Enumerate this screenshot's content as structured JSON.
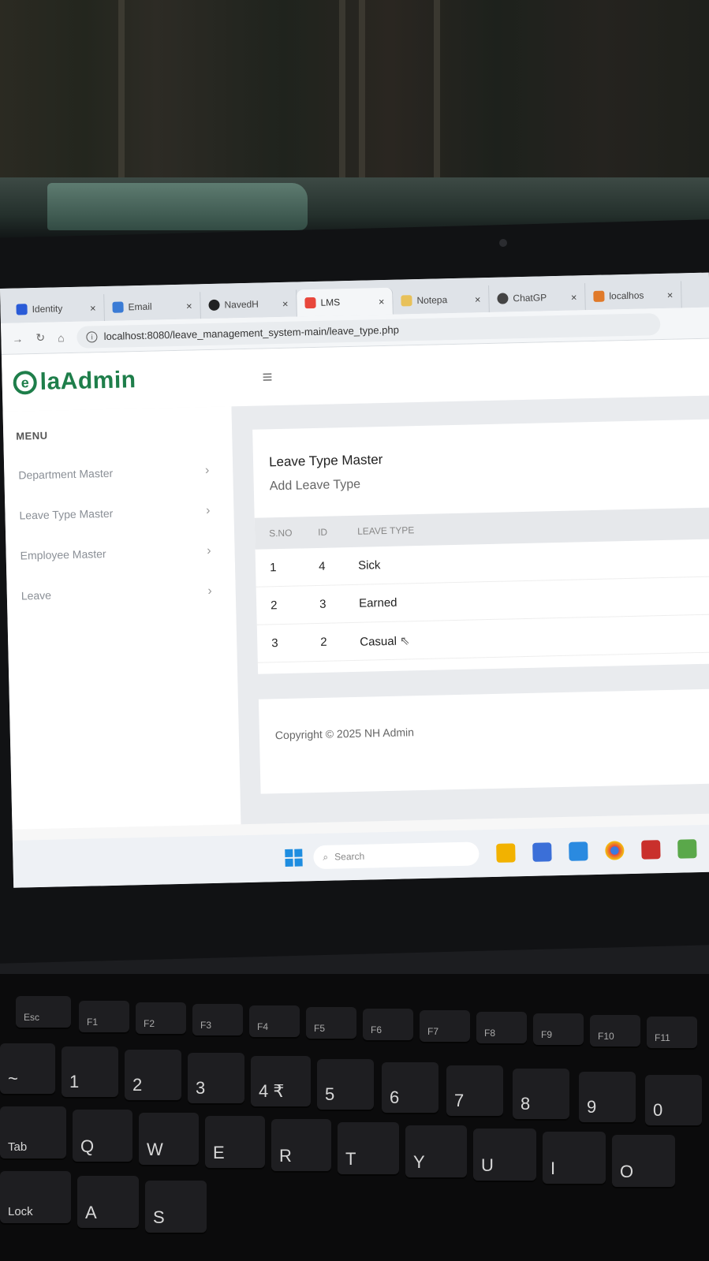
{
  "browser": {
    "tabs": [
      {
        "label": "Identity",
        "icon_color": "#2a5bd7",
        "active": false
      },
      {
        "label": "Email",
        "icon_color": "#3a7bd5",
        "active": false
      },
      {
        "label": "NavedH",
        "icon_color": "#222222",
        "active": false
      },
      {
        "label": "LMS",
        "icon_color": "#e8473c",
        "active": true
      },
      {
        "label": "Notepa",
        "icon_color": "#e8c15a",
        "active": false
      },
      {
        "label": "ChatGP",
        "icon_color": "#444444",
        "active": false
      },
      {
        "label": "localhos",
        "icon_color": "#e07a2a",
        "active": false
      }
    ],
    "close_glyph": "×",
    "url": "localhost:8080/leave_management_system-main/leave_type.php"
  },
  "app": {
    "logo_letter": "e",
    "logo_text": "laAdmin",
    "brand_color": "#1e7e4a"
  },
  "sidebar": {
    "menu_title": "MENU",
    "items": [
      {
        "label": "Department Master"
      },
      {
        "label": "Leave Type Master"
      },
      {
        "label": "Employee Master"
      },
      {
        "label": "Leave"
      }
    ]
  },
  "main": {
    "card_title": "Leave Type Master",
    "add_link": "Add Leave Type",
    "table": {
      "headers": [
        "S.NO",
        "ID",
        "LEAVE TYPE"
      ],
      "rows": [
        {
          "sno": "1",
          "id": "4",
          "type": "Sick"
        },
        {
          "sno": "2",
          "id": "3",
          "type": "Earned"
        },
        {
          "sno": "3",
          "id": "2",
          "type": "Casual"
        }
      ]
    },
    "footer": "Copyright © 2025 NH Admin"
  },
  "taskbar": {
    "search_placeholder": "Search"
  },
  "keyboard": {
    "fn_row": [
      "Esc",
      "F1",
      "F2",
      "F3",
      "F4",
      "F5",
      "F6",
      "F7",
      "F8",
      "F9",
      "F10",
      "F11"
    ],
    "num_row": [
      "~",
      "1",
      "2",
      "3",
      "4 ₹",
      "5",
      "6",
      "7",
      "8",
      "9",
      "0"
    ],
    "q_row": [
      "Tab",
      "Q",
      "W",
      "E",
      "R",
      "T",
      "Y",
      "U",
      "I",
      "O"
    ],
    "a_row": [
      "Lock",
      "A",
      "S"
    ]
  }
}
